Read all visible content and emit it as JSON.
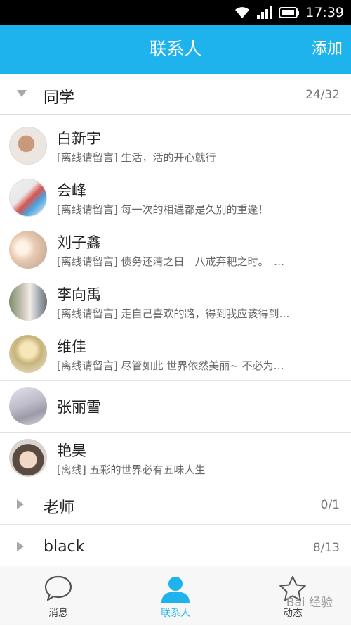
{
  "status": {
    "time": "17:39"
  },
  "header": {
    "title": "联系人",
    "add_label": "添加"
  },
  "groups": [
    {
      "name": "同学",
      "count": "24/32"
    },
    {
      "name": "老师",
      "count": "0/1"
    },
    {
      "name": "black",
      "count": "8/13"
    }
  ],
  "contacts": [
    {
      "name": "白新宇",
      "signature": "[离线请留言] 生活，活的开心就行"
    },
    {
      "name": "会峰",
      "signature": "[离线请留言] 每一次的相遇都是久别的重逢！"
    },
    {
      "name": "刘子鑫",
      "signature": "[离线请留言] 债务还清之日　八戒弃耙之时。　…"
    },
    {
      "name": "李向禹",
      "signature": "[离线请留言] 走自己喜欢的路，得到我应该得到…"
    },
    {
      "name": "维佳",
      "signature": "[离线请留言] 尽管如此 世界依然美丽~ 不必为…"
    },
    {
      "name": "张丽雪",
      "signature": ""
    },
    {
      "name": "艳昊",
      "signature": "[离线] 五彩的世界必有五味人生"
    }
  ],
  "nav": {
    "messages_label": "消息",
    "contacts_label": "联系人",
    "feed_label": "动态"
  },
  "watermark": "Bai 经验",
  "colors": {
    "accent": "#1fb3ee"
  }
}
